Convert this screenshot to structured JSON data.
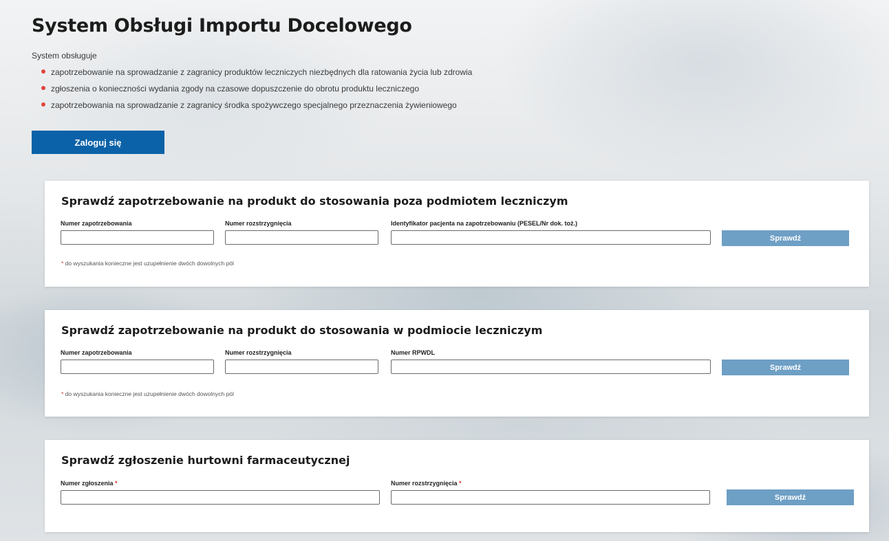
{
  "header": {
    "title": "System Obsługi Importu Docelowego",
    "intro": "System obsługuje",
    "features": [
      "zapotrzebowanie na sprowadzanie z zagranicy produktów leczniczych niezbędnych dla ratowania życia lub zdrowia",
      "zgłoszenia o konieczności wydania zgody na czasowe dopuszczenie do obrotu produktu leczniczego",
      "zapotrzebowania na sprowadzanie z zagranicy środka spożywczego specjalnego przeznaczenia żywieniowego"
    ],
    "login_label": "Zaloguj się"
  },
  "cards": [
    {
      "title": "Sprawdź zapotrzebowanie na produkt do stosowania poza podmiotem leczniczym",
      "fields": [
        {
          "label": "Numer zapotrzebowania",
          "value": ""
        },
        {
          "label": "Numer rozstrzygnięcia",
          "value": ""
        },
        {
          "label": "Identyfikator pacjenta na zapotrzebowaniu (PESEL/Nr dok. toż.)",
          "value": ""
        }
      ],
      "button_label": "Sprawdź",
      "hint_mark": "*",
      "hint": " do wyszukania konieczne jest uzupełnienie dwóch dowolnych pól"
    },
    {
      "title": "Sprawdź zapotrzebowanie na produkt do stosowania w podmiocie leczniczym",
      "fields": [
        {
          "label": "Numer zapotrzebowania",
          "value": ""
        },
        {
          "label": "Numer rozstrzygnięcia",
          "value": ""
        },
        {
          "label": "Numer RPWDL",
          "value": ""
        }
      ],
      "button_label": "Sprawdź",
      "hint_mark": "*",
      "hint": " do wyszukania konieczne jest uzupełnienie dwóch dowolnych pól"
    },
    {
      "title": "Sprawdź zgłoszenie hurtowni farmaceutycznej",
      "fields": [
        {
          "label": "Numer zgłoszenia",
          "required_mark": "*",
          "value": ""
        },
        {
          "label": "Numer rozstrzygnięcia",
          "required_mark": "*",
          "value": ""
        }
      ],
      "button_label": "Sprawdź"
    }
  ],
  "colors": {
    "primary": "#0b62a8",
    "secondary_button": "#6e9fc5",
    "bullet": "#e0443a",
    "required": "#d9362b"
  }
}
